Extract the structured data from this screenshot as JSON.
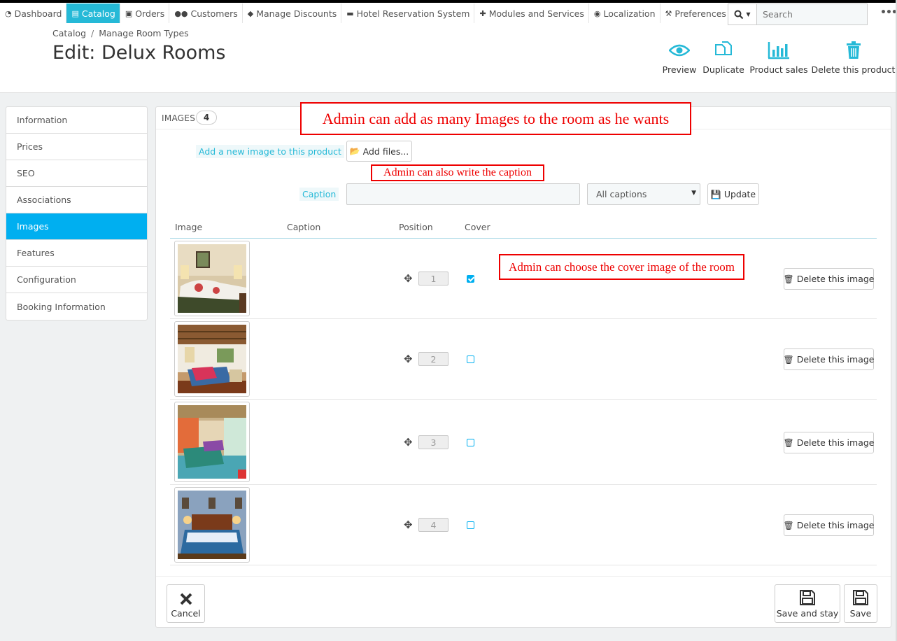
{
  "nav": {
    "items": [
      {
        "label": "Dashboard",
        "icon": "dashboard-icon"
      },
      {
        "label": "Catalog",
        "icon": "book-icon"
      },
      {
        "label": "Orders",
        "icon": "credit-card-icon"
      },
      {
        "label": "Customers",
        "icon": "users-icon"
      },
      {
        "label": "Manage Discounts",
        "icon": "tags-icon"
      },
      {
        "label": "Hotel Reservation System",
        "icon": "bed-icon"
      },
      {
        "label": "Modules and Services",
        "icon": "puzzle-icon"
      },
      {
        "label": "Localization",
        "icon": "globe-icon"
      },
      {
        "label": "Preferences",
        "icon": "wrench-icon"
      }
    ],
    "active": "Catalog",
    "search_placeholder": "Search"
  },
  "header": {
    "breadcrumb": [
      "Catalog",
      "Manage Room Types"
    ],
    "title": "Edit: Delux Rooms",
    "toolbar": {
      "preview": "Preview",
      "duplicate": "Duplicate",
      "product_sales": "Product sales",
      "delete": "Delete this product"
    }
  },
  "sidebar": {
    "items": [
      "Information",
      "Prices",
      "SEO",
      "Associations",
      "Images",
      "Features",
      "Configuration",
      "Booking Information"
    ],
    "active": "Images"
  },
  "images_panel": {
    "title": "IMAGES",
    "count": "4",
    "add_label": "Add a new image to this product",
    "add_button": "Add files...",
    "caption_label": "Caption",
    "caption_value": "",
    "captions_select": "All captions",
    "update_button": "Update",
    "columns": {
      "image": "Image",
      "caption": "Caption",
      "position": "Position",
      "cover": "Cover"
    },
    "rows": [
      {
        "position": "1",
        "cover": true,
        "caption": "",
        "delete": "Delete this image"
      },
      {
        "position": "2",
        "cover": false,
        "caption": "",
        "delete": "Delete this image"
      },
      {
        "position": "3",
        "cover": false,
        "caption": "",
        "delete": "Delete this image"
      },
      {
        "position": "4",
        "cover": false,
        "caption": "",
        "delete": "Delete this image"
      }
    ]
  },
  "callouts": {
    "add_images": "Admin can add as many Images to the room as he wants",
    "caption": "Admin can also write the caption",
    "cover": "Admin can choose the cover image of the room"
  },
  "footer": {
    "cancel": "Cancel",
    "save_and_stay": "Save and stay",
    "save": "Save"
  },
  "colors": {
    "accent": "#25b9d7",
    "active_sidebar": "#00aff0",
    "callout": "#e00000"
  }
}
